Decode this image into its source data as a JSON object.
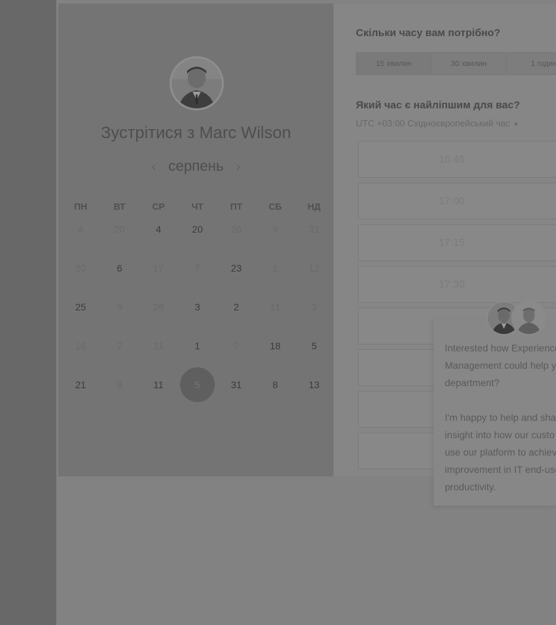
{
  "meeting": {
    "title": "Зустрітися з Marc Wilson",
    "month": "серпень",
    "prev_icon": "chevron-left-icon",
    "next_icon": "chevron-right-icon"
  },
  "calendar": {
    "weekdays": [
      "ПН",
      "ВТ",
      "СР",
      "ЧТ",
      "ПТ",
      "СБ",
      "НД"
    ],
    "weeks": [
      [
        {
          "d": "4",
          "a": false
        },
        {
          "d": "20",
          "a": false
        },
        {
          "d": "4",
          "a": true
        },
        {
          "d": "20",
          "a": true
        },
        {
          "d": "26",
          "a": false
        },
        {
          "d": "9",
          "a": false
        },
        {
          "d": "31",
          "a": false
        }
      ],
      [
        {
          "d": "20",
          "a": false
        },
        {
          "d": "6",
          "a": true
        },
        {
          "d": "17",
          "a": false
        },
        {
          "d": "7",
          "a": false
        },
        {
          "d": "23",
          "a": true
        },
        {
          "d": "1",
          "a": false
        },
        {
          "d": "12",
          "a": false
        }
      ],
      [
        {
          "d": "25",
          "a": true
        },
        {
          "d": "9",
          "a": false
        },
        {
          "d": "26",
          "a": false
        },
        {
          "d": "3",
          "a": true
        },
        {
          "d": "2",
          "a": true
        },
        {
          "d": "11",
          "a": false
        },
        {
          "d": "3",
          "a": false
        }
      ],
      [
        {
          "d": "16",
          "a": false
        },
        {
          "d": "7",
          "a": false
        },
        {
          "d": "11",
          "a": false
        },
        {
          "d": "1",
          "a": true
        },
        {
          "d": "7",
          "a": false
        },
        {
          "d": "18",
          "a": true
        },
        {
          "d": "5",
          "a": true
        }
      ],
      [
        {
          "d": "21",
          "a": true
        },
        {
          "d": "8",
          "a": false
        },
        {
          "d": "11",
          "a": true
        },
        {
          "d": "5",
          "a": true,
          "selected": true
        },
        {
          "d": "31",
          "a": true
        },
        {
          "d": "8",
          "a": true
        },
        {
          "d": "13",
          "a": true
        }
      ]
    ]
  },
  "booking": {
    "duration_question": "Скільки часу вам потрібно?",
    "durations": [
      "15 хвилин",
      "30 хвилин",
      "1 годин"
    ],
    "active_duration": 0,
    "time_question": "Який час є найліпшим для вас?",
    "timezone": "UTC +03:00 Східноєвропейський час",
    "slots": [
      "16:45",
      "17:00",
      "17:15",
      "17:30",
      "",
      "",
      "",
      ""
    ]
  },
  "chat": {
    "paragraph_1": [
      "Interested how Experience",
      "Management could help y",
      "department?"
    ],
    "paragraph_2": [
      "I'm happy to help and sha",
      "insight into how our custo",
      "use our platform to achiev",
      "improvement in IT end-use",
      "productivity."
    ]
  }
}
